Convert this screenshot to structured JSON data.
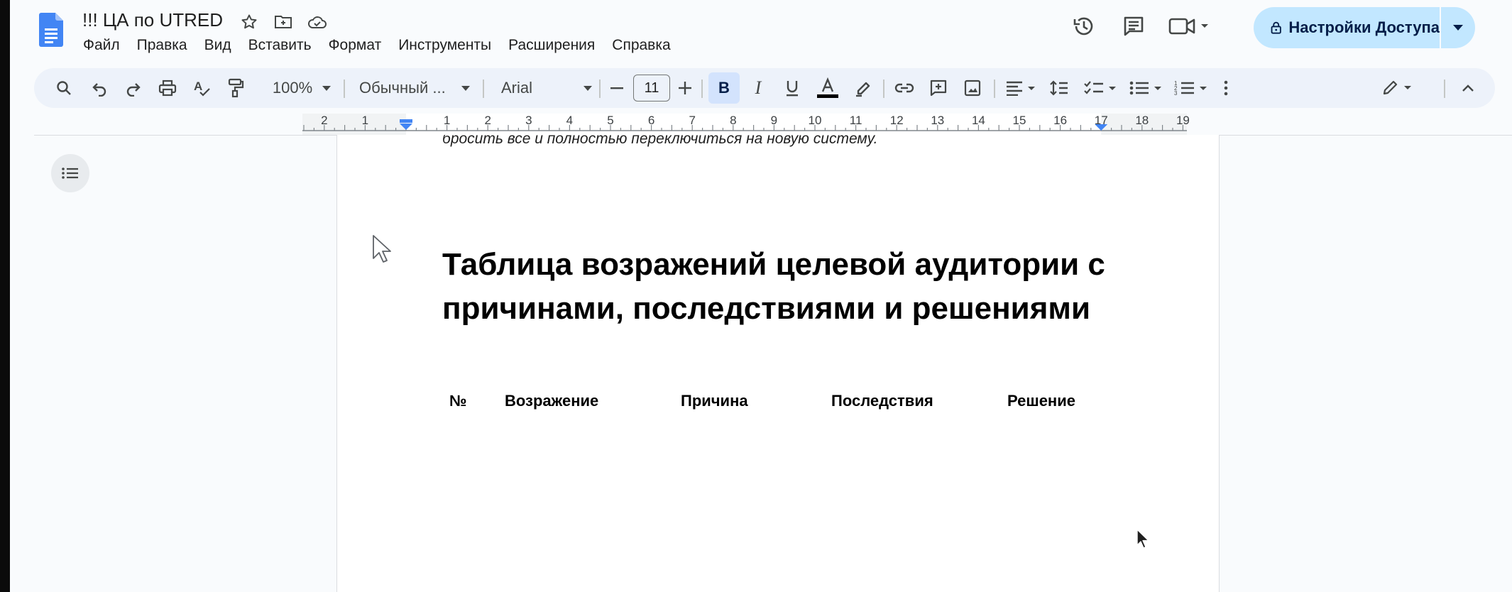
{
  "document": {
    "title": "!!! ЦА по UTRED",
    "menu": [
      "Файл",
      "Правка",
      "Вид",
      "Вставить",
      "Формат",
      "Инструменты",
      "Расширения",
      "Справка"
    ]
  },
  "share": {
    "label": "Настройки Доступа"
  },
  "toolbar": {
    "zoom": "100%",
    "style": "Обычный ...",
    "font": "Arial",
    "font_size": "11",
    "bold_active": true
  },
  "ruler": {
    "labels": [
      "2",
      "1",
      "1",
      "2",
      "3",
      "4",
      "5",
      "6",
      "7",
      "8",
      "9",
      "10",
      "11",
      "12",
      "13",
      "14",
      "15",
      "16",
      "17",
      "18",
      "19"
    ]
  },
  "content": {
    "prev_line": "бросить всё и полностью переключиться на новую систему.",
    "heading": "Таблица возражений целевой аудитории с причинами, последствиями и решениями",
    "table_headers": [
      "№",
      "Возражение",
      "Причина",
      "Последствия",
      "Решение"
    ]
  },
  "colors": {
    "share_bg": "#c2e7ff",
    "toolbar_bg": "#edf2fa",
    "active_bg": "#d3e3fd",
    "ruler_marker": "#4285f4",
    "docs_blue": "#4285f4"
  }
}
